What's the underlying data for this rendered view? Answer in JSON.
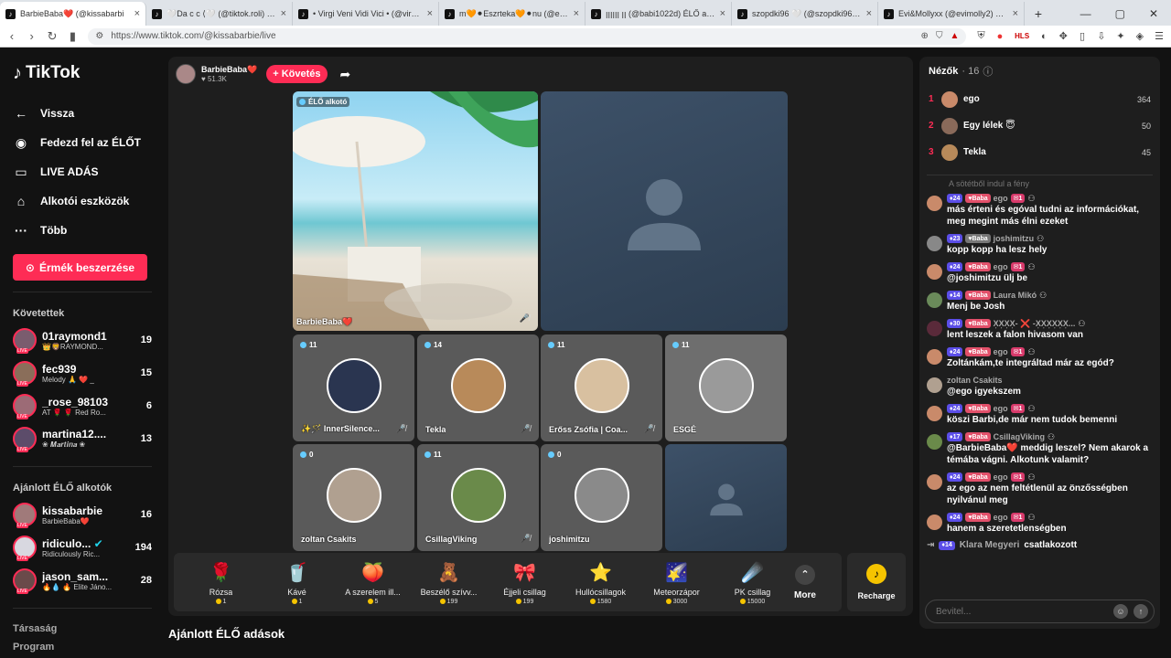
{
  "browser": {
    "tabs": [
      {
        "title": "BarbieBaba❤️ (@kissabarbi",
        "active": true
      },
      {
        "title": "🤍Da c c ⟨🤍 (@tiktok.roli) ÉLŐ adá"
      },
      {
        "title": "• Virgi Veni Vidi Vici • (@virgivenivic"
      },
      {
        "title": "m🧡⚫Eszrteka🧡⚫nu (@eurekaeur"
      },
      {
        "title": "ꞁꞁꞁꞁꞁꞁ ꞁꞁ (@babi1022d) ÉLŐ adásbe"
      },
      {
        "title": "szopdki96 🤍 (@szopdki96) ÉLŐ adás"
      },
      {
        "title": "Evi&Mollyxx (@evimolly2) ÉLŐ adás"
      }
    ],
    "new_tab": "+",
    "url": "https://www.tiktok.com/@kissabarbie/live",
    "ext_label": "HLS"
  },
  "sidebar": {
    "brand": "TikTok",
    "nav": [
      {
        "icon": "←",
        "label": "Vissza"
      },
      {
        "icon": "◉",
        "label": "Fedezd fel az ÉLŐT"
      },
      {
        "icon": "▭",
        "label": "LIVE ADÁS"
      },
      {
        "icon": "⌂",
        "label": "Alkotói eszközök"
      },
      {
        "icon": "···",
        "label": "Több"
      }
    ],
    "coins_button": "Érmék beszerzése",
    "following_title": "Követettek",
    "following": [
      {
        "name": "01raymond1",
        "sub": "👑🦁RAYMOND...",
        "count": "19",
        "color": "#7a5c6e"
      },
      {
        "name": "fec939",
        "sub": "Melody 🙏 ❤️ _",
        "count": "15",
        "color": "#8a6e5a"
      },
      {
        "name": "_rose_98103",
        "sub": "AT 🌹 🌹 Red Ro...",
        "count": "6",
        "color": "#9c6b76"
      },
      {
        "name": "martina12....",
        "sub": "❀ 𝑴𝒂𝒓𝒕𝒊𝒏𝒂 ❀",
        "count": "13",
        "color": "#5c4c6a"
      }
    ],
    "recommended_title": "Ajánlott ÉLŐ alkotók",
    "recommended": [
      {
        "name": "kissabarbie",
        "sub": "BarbieBaba❤️",
        "count": "16",
        "color": "#a07a7a"
      },
      {
        "name": "ridiculo...",
        "sub": "Ridiculously Ric...",
        "count": "194",
        "color": "#d8d8e0",
        "verified": true
      },
      {
        "name": "jason_sam...",
        "sub": "🔥💧 🔥 Elite Jáno...",
        "count": "28",
        "color": "#6a4a4a"
      }
    ],
    "footer": [
      "Társaság",
      "Program"
    ]
  },
  "stage": {
    "host_name": "BarbieBaba❤️",
    "host_likes": "♥ 51.3K",
    "follow_button": "+ Követés",
    "main_tag": "ÉLŐ alkotó",
    "main_name": "BarbieBaba❤️",
    "guests": [
      {
        "name": "✨🪄 InnerSilence...",
        "count": "11",
        "color": "#2a3550"
      },
      {
        "name": "Tekla",
        "count": "14",
        "color": "#b88a5a"
      },
      {
        "name": "Erőss Zsófia | Coa...",
        "count": "11",
        "color": "#d8c0a0"
      },
      {
        "name": "ESGÉ",
        "count": "11",
        "color": "#9a9a9a"
      },
      {
        "name": "zoltan Csakits",
        "count": "0",
        "color": "#b0a090"
      },
      {
        "name": "CsillagViking",
        "count": "11",
        "color": "#6a8a4a"
      },
      {
        "name": "joshimitzu",
        "count": "0",
        "color": "#8a8a8a"
      }
    ]
  },
  "gifts": [
    {
      "name": "Rózsa",
      "price": "1",
      "icon": "🌹"
    },
    {
      "name": "Kávé",
      "price": "1",
      "icon": "🥤"
    },
    {
      "name": "A szerelem ill...",
      "price": "5",
      "icon": "🍑"
    },
    {
      "name": "Beszélő szívv...",
      "price": "199",
      "icon": "🧸"
    },
    {
      "name": "Éjjeli csillag",
      "price": "199",
      "icon": "🎀"
    },
    {
      "name": "Hullócsillagok",
      "price": "1580",
      "icon": "⭐"
    },
    {
      "name": "Meteorzápor",
      "price": "3000",
      "icon": "🌠"
    },
    {
      "name": "PK csillag",
      "price": "15000",
      "icon": "☄️"
    }
  ],
  "gift_more": "More",
  "recharge": "Recharge",
  "recommended_section": "Ajánlott ÉLŐ adások",
  "chat": {
    "viewers_title": "Nézők",
    "viewers_count": "· 16",
    "top_viewers": [
      {
        "rank": "1",
        "name": "ego",
        "score": "364",
        "color": "#c98a6a"
      },
      {
        "rank": "2",
        "name": "Egy lélek 😇",
        "score": "50",
        "color": "#8a6a5a"
      },
      {
        "rank": "3",
        "name": "Tekla",
        "score": "45",
        "color": "#b88a5a"
      }
    ],
    "faded_line": "A sötétből indul a fény",
    "messages": [
      {
        "lvl": "24",
        "fan": "Baba",
        "user": "ego",
        "ln": "1",
        "text": "más érteni és egóval tudni az információkat, meg megint más élni ezeket",
        "color": "#c98a6a"
      },
      {
        "lvl": "23",
        "fan": "Baba",
        "user": "joshimitzu",
        "ln": "",
        "text": "kopp kopp ha lesz hely",
        "color": "#888"
      },
      {
        "lvl": "24",
        "fan": "Baba",
        "user": "ego",
        "ln": "1",
        "text": "@joshimitzu ülj be",
        "color": "#c98a6a"
      },
      {
        "lvl": "14",
        "fan": "Baba",
        "user": "Laura Mikó",
        "ln": "",
        "text": "Menj be Josh",
        "color": "#6a8a5a"
      },
      {
        "lvl": "30",
        "fan": "Baba",
        "user": "X͎X͎X͎X͎- ❌ -X͎X͎X͎X͎X͎X͎...",
        "ln": "",
        "text": "lent leszek a falon hivasom van",
        "color": "#5a2a3a"
      },
      {
        "lvl": "24",
        "fan": "Baba",
        "user": "ego",
        "ln": "1",
        "text": "Zoltánkám,te integráltad már az egód?",
        "color": "#c98a6a"
      },
      {
        "lvl": "",
        "fan": "",
        "user": "zoltan Csakits",
        "ln": "",
        "text": "@ego igyekszem",
        "color": "#b0a090"
      },
      {
        "lvl": "24",
        "fan": "Baba",
        "user": "ego",
        "ln": "1",
        "text": "köszi Barbi,de már nem tudok bemenni",
        "color": "#c98a6a"
      },
      {
        "lvl": "17",
        "fan": "Baba",
        "user": "CsillagViking",
        "ln": "",
        "text": "@BarbieBaba❤️ meddig leszel? Nem akarok a témába vágni. Alkotunk valamit?",
        "color": "#6a8a4a"
      },
      {
        "lvl": "24",
        "fan": "Baba",
        "user": "ego",
        "ln": "1",
        "text": "az ego az nem feltétlenül az önzősségben nyilvánul meg",
        "color": "#c98a6a"
      },
      {
        "lvl": "24",
        "fan": "Baba",
        "user": "ego",
        "ln": "1",
        "text": "hanem a szeretetlenségben",
        "color": "#c98a6a"
      }
    ],
    "joined_level": "14",
    "joined_name": "Klara Megyeri",
    "joined_text": "csatlakozott",
    "input_placeholder": "Bevitel..."
  }
}
